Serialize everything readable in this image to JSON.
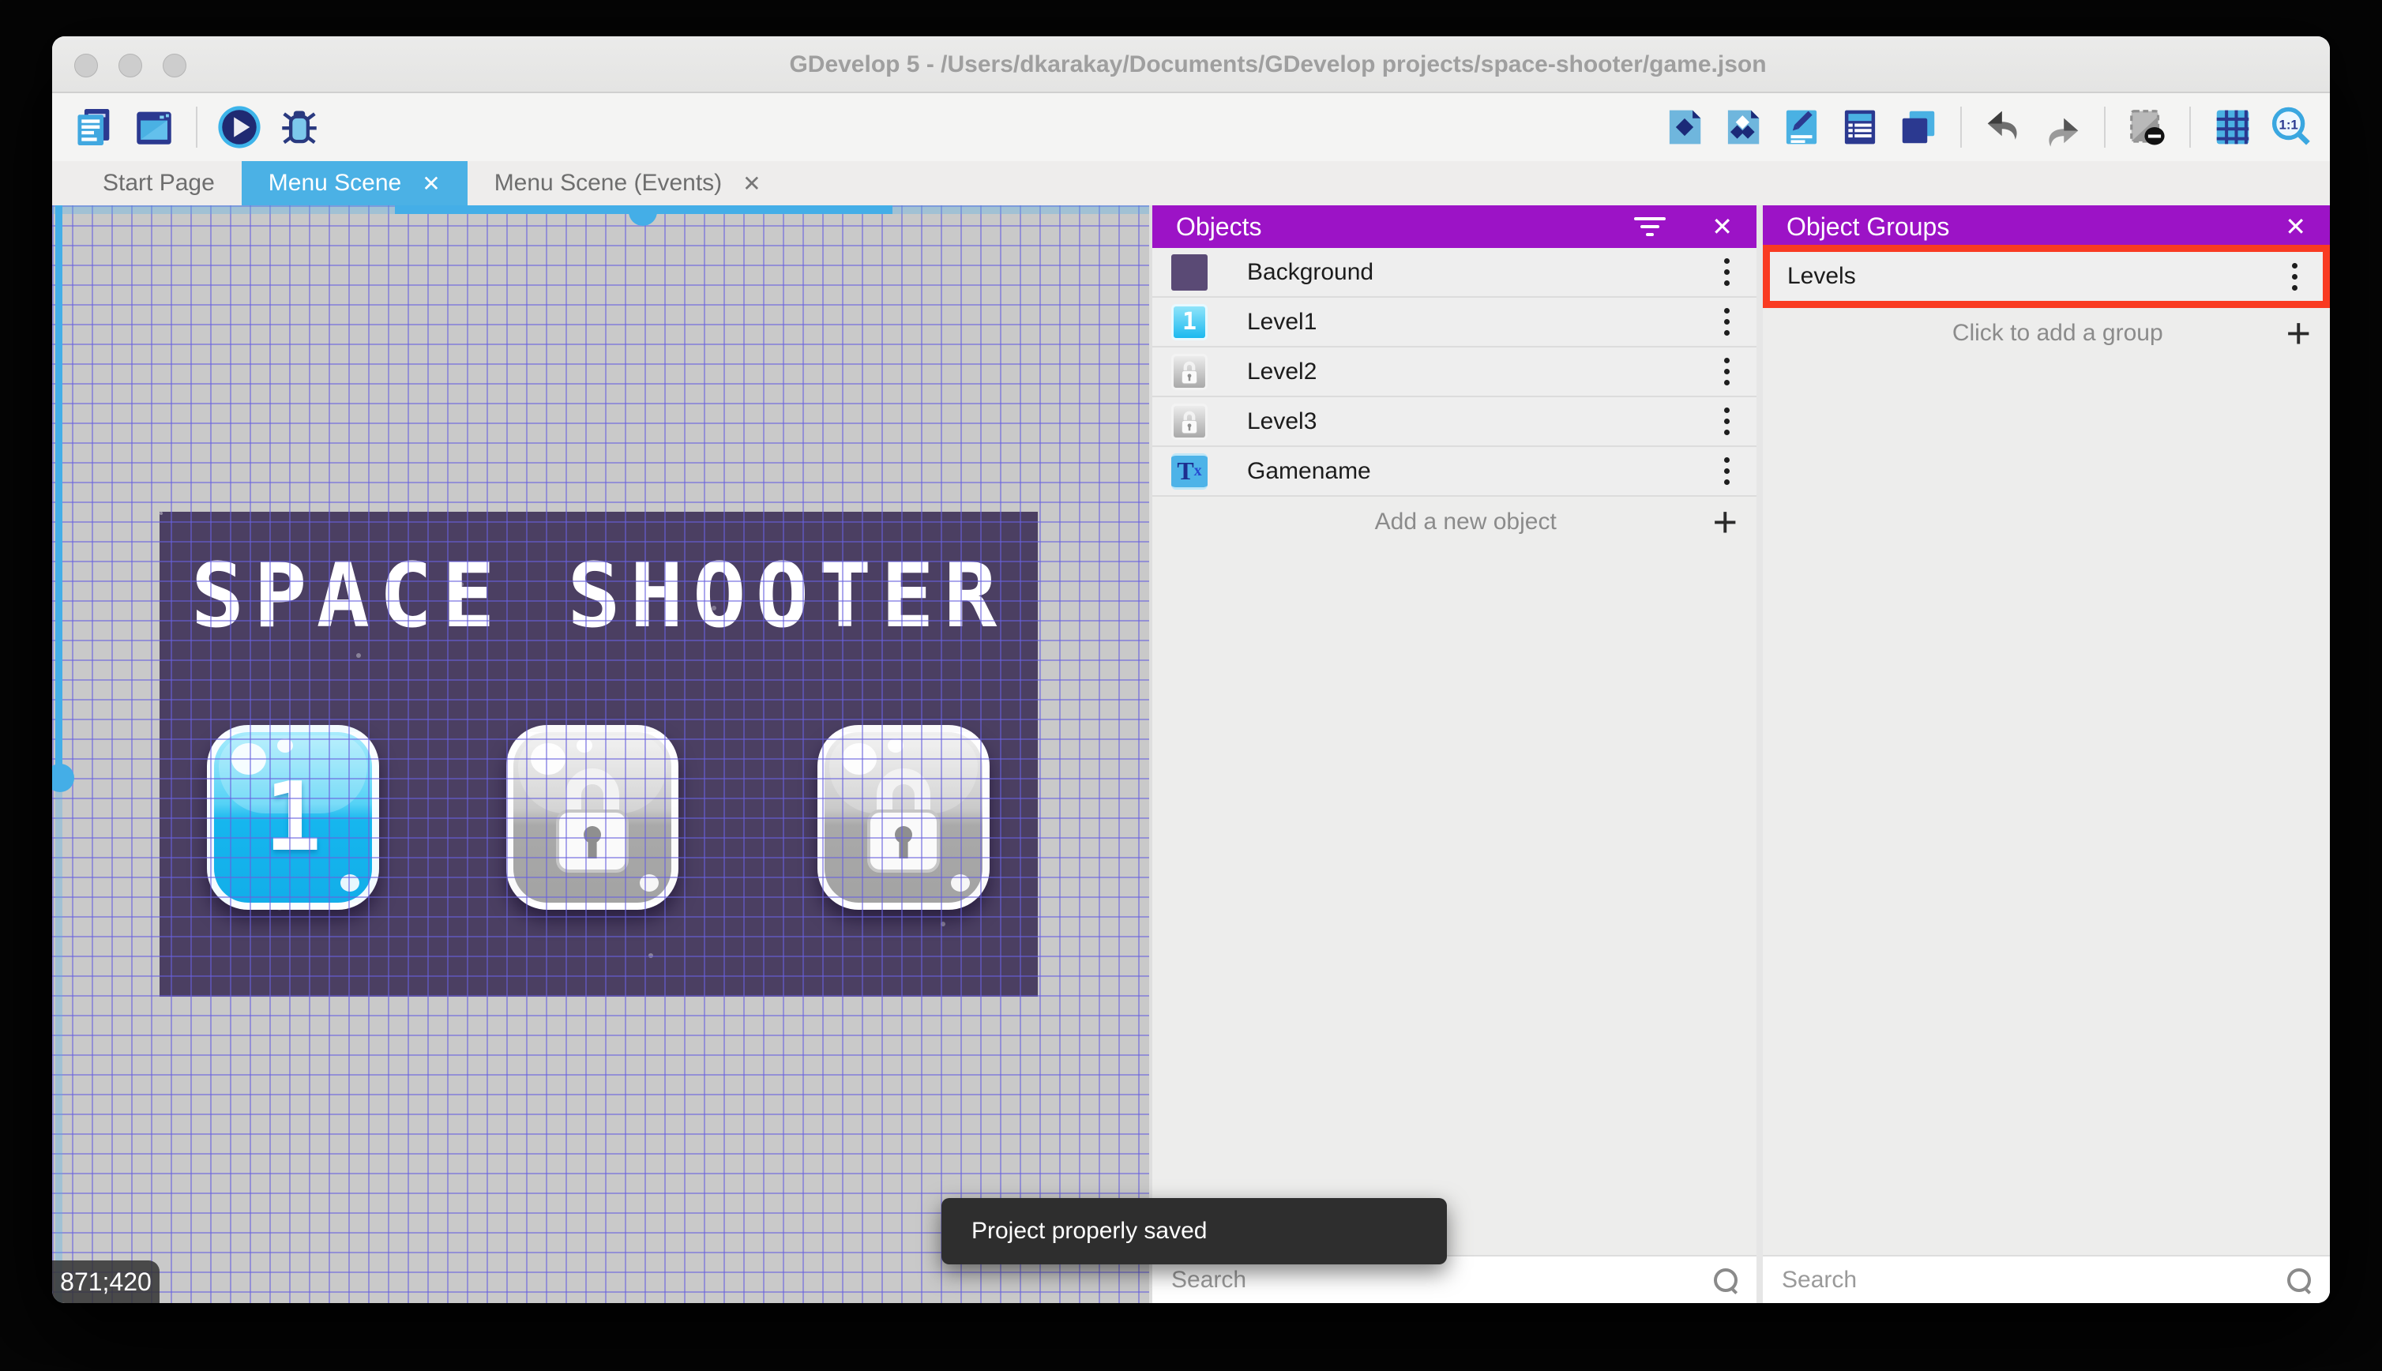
{
  "window": {
    "title": "GDevelop 5 - /Users/dkarakay/Documents/GDevelop projects/space-shooter/game.json"
  },
  "toolbar": {
    "left_icons": [
      "project-manager",
      "scene-editor",
      "play",
      "debug"
    ],
    "right_icons": [
      "objects-panel",
      "object-groups-panel",
      "properties",
      "instances-list",
      "layers",
      "undo",
      "redo",
      "mask-toggle",
      "grid",
      "zoom-one-to-one"
    ],
    "zoom_label": "1:1"
  },
  "tabs": [
    {
      "label": "Start Page",
      "active": false
    },
    {
      "label": "Menu Scene",
      "active": true
    },
    {
      "label": "Menu Scene (Events)",
      "active": false
    }
  ],
  "icons": {
    "close": "✕",
    "plus": "+",
    "text_t": "T",
    "text_x": "x"
  },
  "scene": {
    "title_text": "SPACE SHOOTER",
    "level_button_label": "1",
    "coordinates": "871;420"
  },
  "objects_panel": {
    "title": "Objects",
    "items": [
      {
        "name": "Background",
        "thumb": "background"
      },
      {
        "name": "Level1",
        "thumb": "level1"
      },
      {
        "name": "Level2",
        "thumb": "lock"
      },
      {
        "name": "Level3",
        "thumb": "lock"
      },
      {
        "name": "Gamename",
        "thumb": "text"
      }
    ],
    "add_label": "Add a new object",
    "search_placeholder": "Search"
  },
  "groups_panel": {
    "title": "Object Groups",
    "items": [
      {
        "name": "Levels"
      }
    ],
    "add_label": "Click to add a group",
    "search_placeholder": "Search"
  },
  "toast": {
    "message": "Project properly saved"
  },
  "colors": {
    "panel_header": "#9c13c6",
    "active_tab": "#4bb1e5",
    "highlight_red": "#f93b22",
    "scene_background": "#4b3f62"
  }
}
